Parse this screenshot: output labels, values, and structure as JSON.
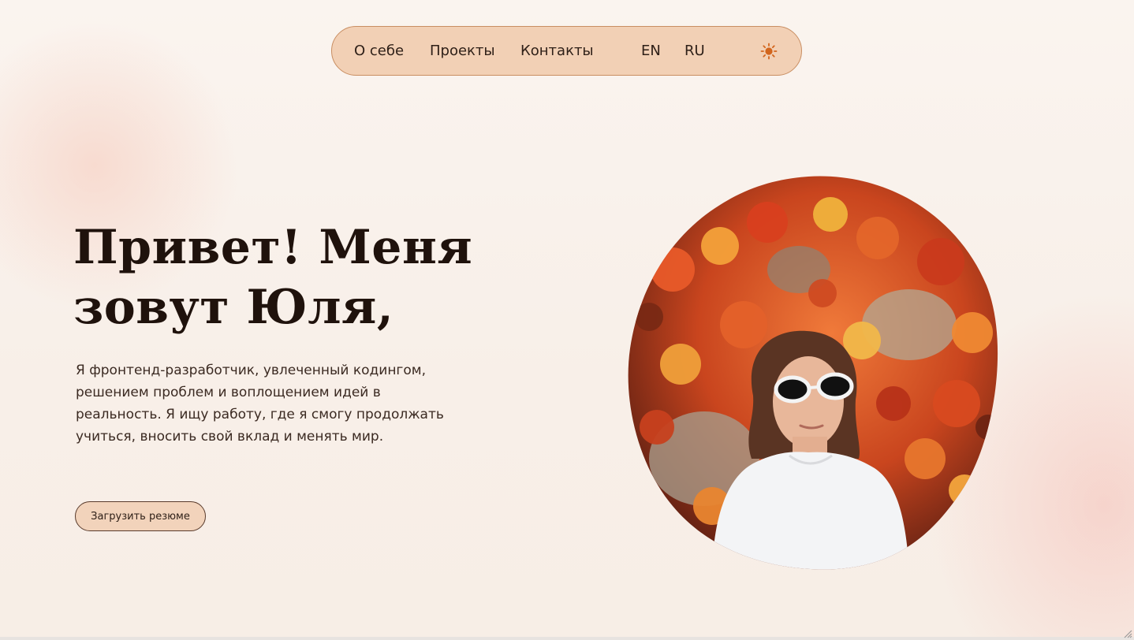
{
  "nav": {
    "links": [
      {
        "label": "О себе"
      },
      {
        "label": "Проекты"
      },
      {
        "label": "Контакты"
      }
    ],
    "languages": [
      "EN",
      "RU"
    ],
    "theme_icon": "sun-icon"
  },
  "hero": {
    "title_line1": "Привет! Меня",
    "title_line2": "зовут Юля,",
    "description": "Я фронтенд-разработчик, увлеченный кодингом, решением проблем и воплощением идей в реальность. Я ищу работу, где я смогу продолжать учиться, вносить свой вклад и менять мир.",
    "resume_button": "Загрузить резюме",
    "photo": "portrait-photo"
  },
  "colors": {
    "background": "#f8efe8",
    "nav_fill": "#f2d0b5",
    "nav_border": "#c98e62",
    "title_text": "#1f120c",
    "body_text": "#3b2a22",
    "sun_icon": "#d2651d"
  }
}
